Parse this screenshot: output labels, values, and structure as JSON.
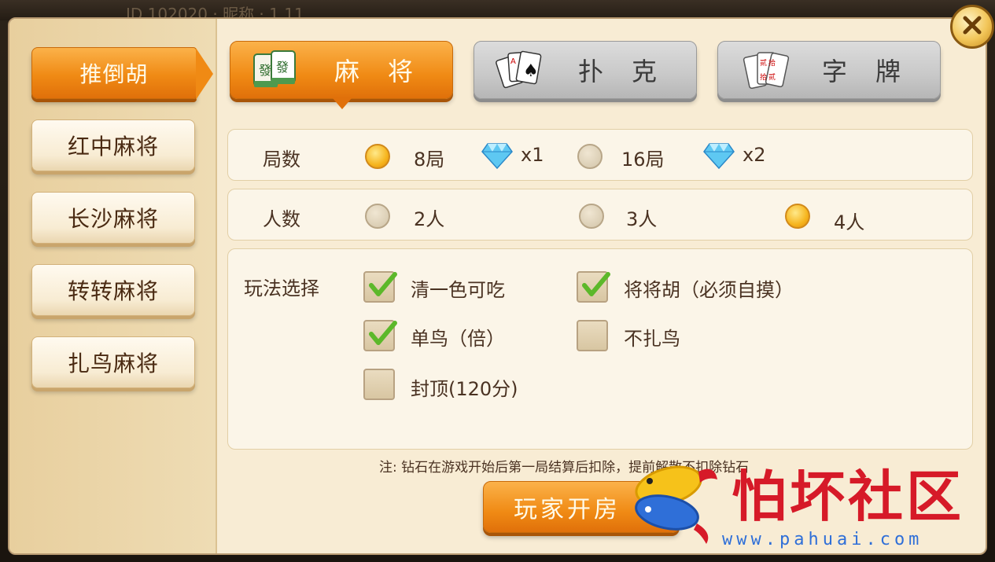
{
  "top_bar": {
    "ghost_text": "ID 102020 · 昵称 · 1.11"
  },
  "sidebar": {
    "items": [
      {
        "label": "推倒胡",
        "active": true
      },
      {
        "label": "红中麻将",
        "active": false
      },
      {
        "label": "长沙麻将",
        "active": false
      },
      {
        "label": "转转麻将",
        "active": false
      },
      {
        "label": "扎鸟麻将",
        "active": false
      }
    ]
  },
  "tabs": [
    {
      "label": "麻　将",
      "icon": "mahjong-tile-icon",
      "active": true
    },
    {
      "label": "扑　克",
      "icon": "playing-cards-icon",
      "active": false
    },
    {
      "label": "字　牌",
      "icon": "word-cards-icon",
      "active": false
    }
  ],
  "rounds": {
    "label": "局数",
    "options": [
      {
        "text": "8局",
        "cost": "x1",
        "selected": true
      },
      {
        "text": "16局",
        "cost": "x2",
        "selected": false
      }
    ]
  },
  "players": {
    "label": "人数",
    "options": [
      {
        "text": "2人",
        "selected": false
      },
      {
        "text": "3人",
        "selected": false
      },
      {
        "text": "4人",
        "selected": true
      }
    ]
  },
  "rules": {
    "label": "玩法选择",
    "options": [
      {
        "text": "清一色可吃",
        "checked": true
      },
      {
        "text": "将将胡（必须自摸）",
        "checked": true
      },
      {
        "text": "单鸟（倍）",
        "checked": true
      },
      {
        "text": "不扎鸟",
        "checked": false
      },
      {
        "text": "封顶(120分)",
        "checked": false
      }
    ]
  },
  "note": "注:  钻石在游戏开始后第一局结算后扣除，提前解散不扣除钻石",
  "open_button": "玩家开房",
  "watermark": {
    "title": "怕坏社区",
    "url": "www.pahuai.com"
  },
  "colors": {
    "accent": "#f08a14",
    "panel": "#f8ecd4",
    "check": "#5cb82a",
    "watermark": "#d61a28"
  }
}
